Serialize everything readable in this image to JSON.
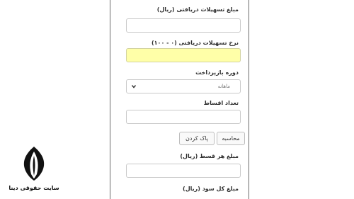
{
  "form": {
    "facility_amount_label": "مبلغ تسهیلات دریافتی (ریال)",
    "facility_amount_value": "",
    "facility_rate_label": "نرخ تسهیلات دریافتی (۰ - ۱۰۰)",
    "facility_rate_value": "",
    "repayment_period_label": "دوره بازپرداخت",
    "repayment_period_selected": "ماهانه",
    "installments_label": "تعداد اقساط",
    "installments_value": "",
    "calculate_label": "محاسبه",
    "clear_label": "پاک کردن",
    "installment_amount_label": "مبلغ هر قسط (ریال)",
    "installment_amount_value": "",
    "total_interest_label": "مبلغ کل سود (ریال)"
  },
  "logo": {
    "text": "سایت حقوقی دینا"
  },
  "colors": {
    "highlight_input": "#ffffa8",
    "panel_border": "#6b6b6b",
    "logo": "#111111"
  }
}
